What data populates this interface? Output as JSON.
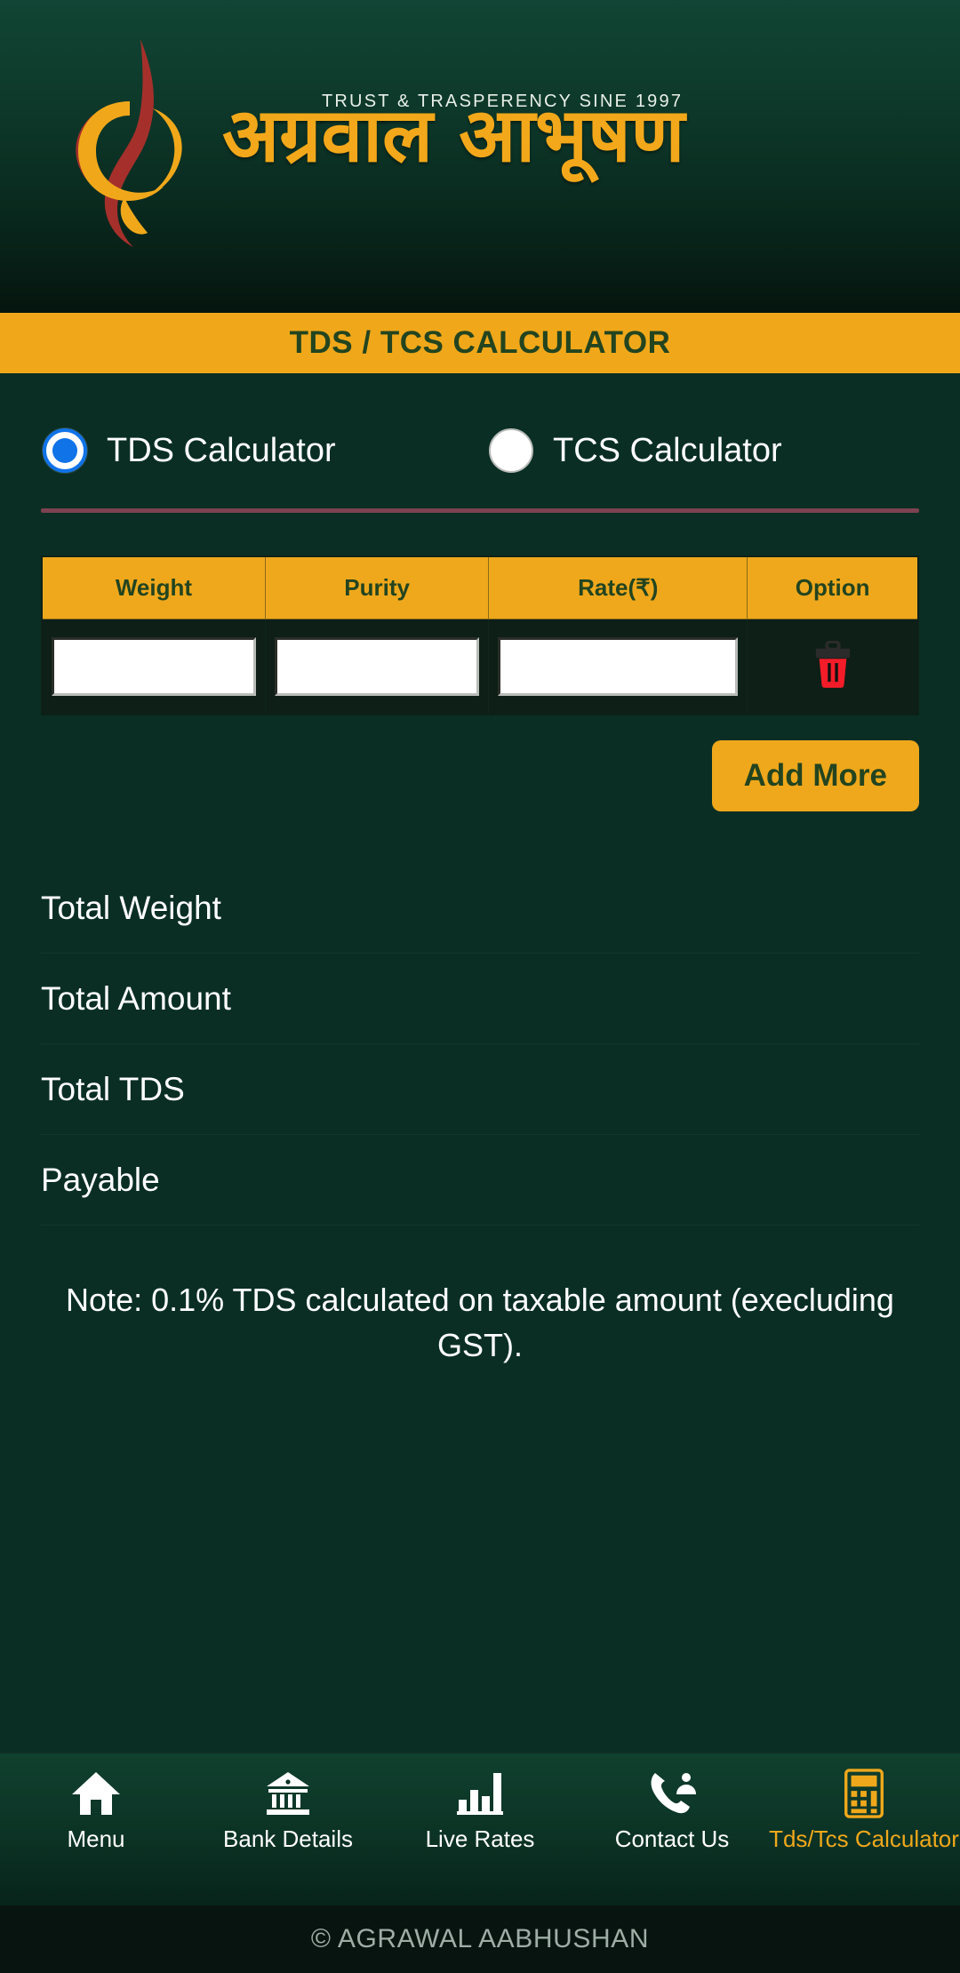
{
  "header": {
    "tagline": "TRUST & TRASPERENCY SINE 1997",
    "brand_hindi": "अग्रवाल आभूषण",
    "logo_icon": "flame-swirl-logo",
    "colors": {
      "amber": "#F0A81A",
      "dark_red": "#A5302B",
      "bg_green": "#0A2E24"
    }
  },
  "title_bar": {
    "title": "TDS / TCS CALCULATOR"
  },
  "calculator_type": {
    "options": [
      {
        "label": "TDS Calculator",
        "selected": true
      },
      {
        "label": "TCS Calculator",
        "selected": false
      }
    ],
    "selected_color": "#1073E8"
  },
  "table": {
    "headers": [
      "Weight",
      "Purity",
      "Rate(₹)",
      "Option"
    ],
    "rows": [
      {
        "weight": "",
        "weight_placeholder": "",
        "purity": "",
        "purity_placeholder": "",
        "rate": "",
        "rate_placeholder": "",
        "delete_icon": "trash-icon"
      }
    ]
  },
  "actions": {
    "add_more_label": "Add More"
  },
  "totals": [
    {
      "label": "Total Weight",
      "value": ""
    },
    {
      "label": "Total Amount",
      "value": ""
    },
    {
      "label": "Total TDS",
      "value": ""
    },
    {
      "label": "Payable",
      "value": ""
    }
  ],
  "note": "Note: 0.1% TDS calculated on taxable amount (execluding GST).",
  "bottom_nav": {
    "items": [
      {
        "label": "Menu",
        "icon": "home-icon",
        "active": false
      },
      {
        "label": "Bank Details",
        "icon": "bank-icon",
        "active": false
      },
      {
        "label": "Live Rates",
        "icon": "bar-chart-icon",
        "active": false
      },
      {
        "label": "Contact Us",
        "icon": "phone-person-icon",
        "active": false
      },
      {
        "label": "Tds/Tcs Calculator",
        "icon": "calculator-icon",
        "active": true
      }
    ],
    "active_color": "#EFA81C"
  },
  "footer": {
    "copyright": "© AGRAWAL AABHUSHAN"
  }
}
